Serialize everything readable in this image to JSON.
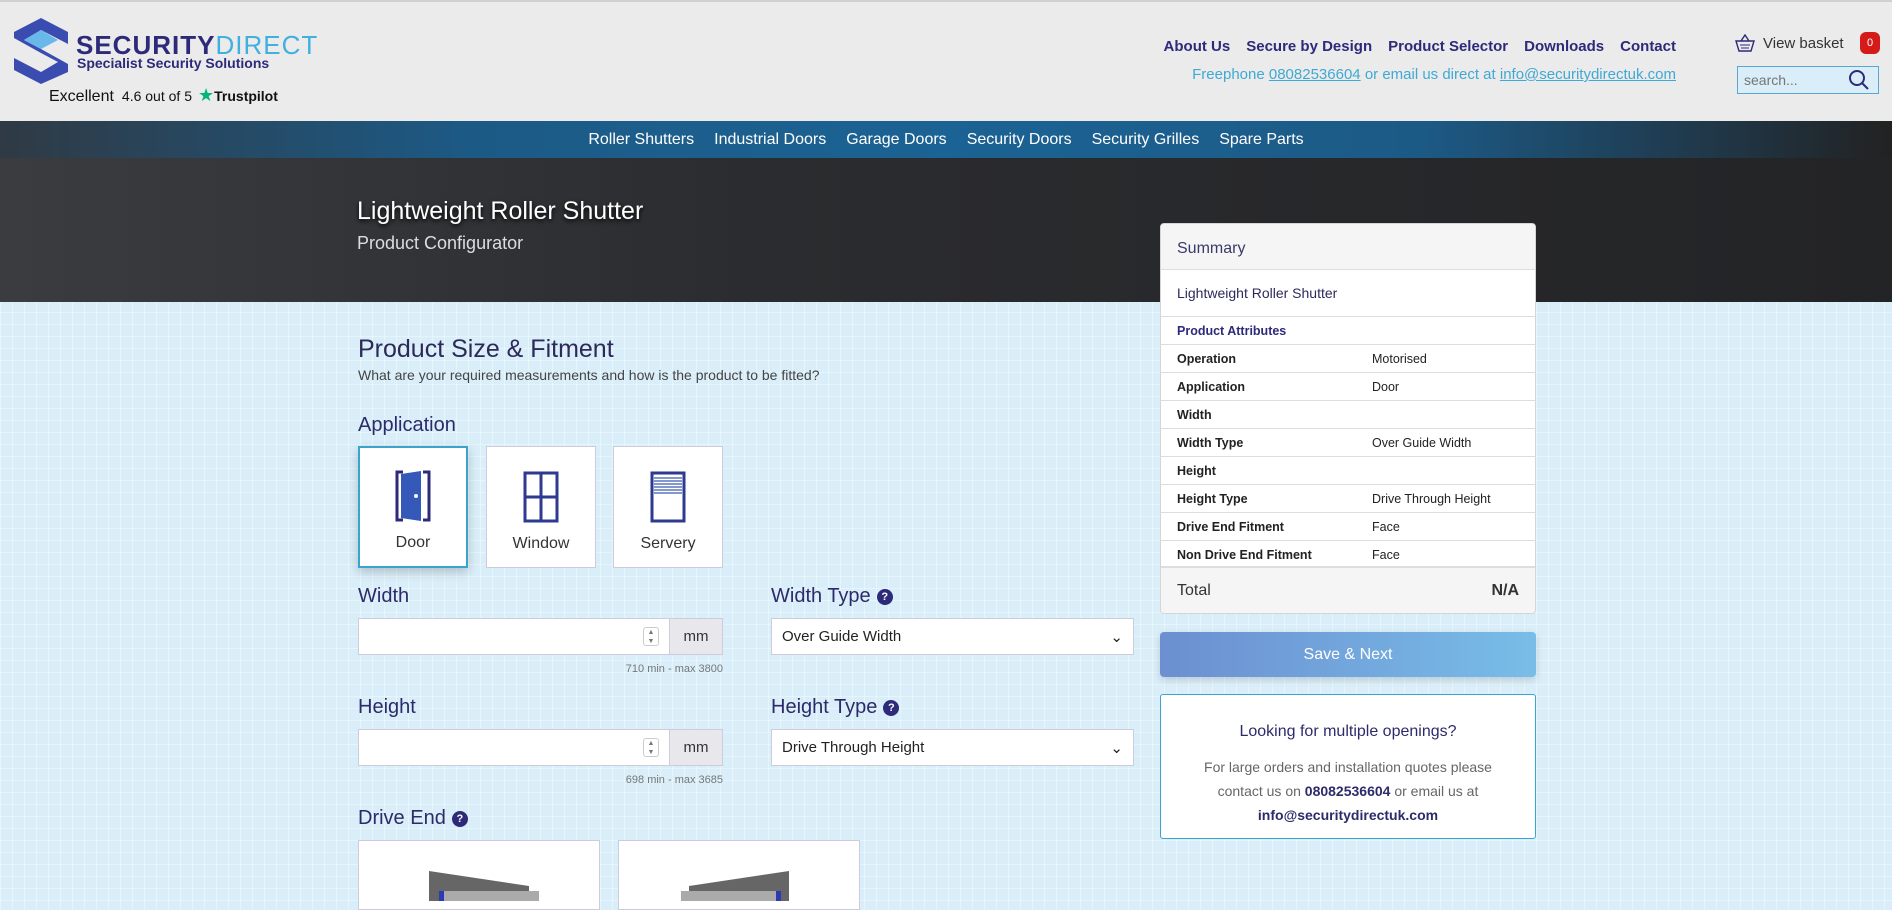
{
  "header": {
    "logo_word1": "SECURITY",
    "logo_word2": "DIRECT",
    "tagline": "Specialist Security Solutions",
    "trustpilot": {
      "rating_word": "Excellent",
      "score": "4.6 out of 5",
      "brand": "Trustpilot"
    },
    "links": [
      "About Us",
      "Secure by Design",
      "Product Selector",
      "Downloads",
      "Contact"
    ],
    "freephone_label": "Freephone",
    "phone": "08082536604",
    "email_text": "or email us direct at",
    "email": "info@securitydirectuk.com",
    "basket_label": "View basket",
    "basket_count": "0",
    "search_placeholder": "search..."
  },
  "nav": [
    "Roller Shutters",
    "Industrial Doors",
    "Garage Doors",
    "Security Doors",
    "Security Grilles",
    "Spare Parts"
  ],
  "hero": {
    "title": "Lightweight Roller Shutter",
    "subtitle": "Product Configurator"
  },
  "form": {
    "section_title": "Product Size & Fitment",
    "section_sub": "What are your required measurements and how is the product to be fitted?",
    "application_label": "Application",
    "applications": [
      "Door",
      "Window",
      "Servery"
    ],
    "width_label": "Width",
    "unit": "mm",
    "width_hint": "710 min - max 3800",
    "width_type_label": "Width Type",
    "width_type_value": "Over Guide Width",
    "height_label": "Height",
    "height_hint": "698 min - max 3685",
    "height_type_label": "Height Type",
    "height_type_value": "Drive Through Height",
    "drive_end_label": "Drive End",
    "help": "?"
  },
  "summary": {
    "title": "Summary",
    "product": "Lightweight Roller Shutter",
    "attributes_title": "Product Attributes",
    "rows": [
      {
        "k": "Operation",
        "v": "Motorised"
      },
      {
        "k": "Application",
        "v": "Door"
      },
      {
        "k": "Width",
        "v": ""
      },
      {
        "k": "Width Type",
        "v": "Over Guide Width"
      },
      {
        "k": "Height",
        "v": ""
      },
      {
        "k": "Height Type",
        "v": "Drive Through Height"
      },
      {
        "k": "Drive End Fitment",
        "v": "Face"
      },
      {
        "k": "Non Drive End Fitment",
        "v": "Face"
      }
    ],
    "total_label": "Total",
    "total_value": "N/A"
  },
  "save_label": "Save & Next",
  "multi": {
    "title": "Looking for multiple openings?",
    "line1": "For large orders and installation quotes please",
    "line2a": "contact us on",
    "phone": "08082536604",
    "line2b": "or email us at",
    "email": "info@securitydirectuk.com"
  }
}
